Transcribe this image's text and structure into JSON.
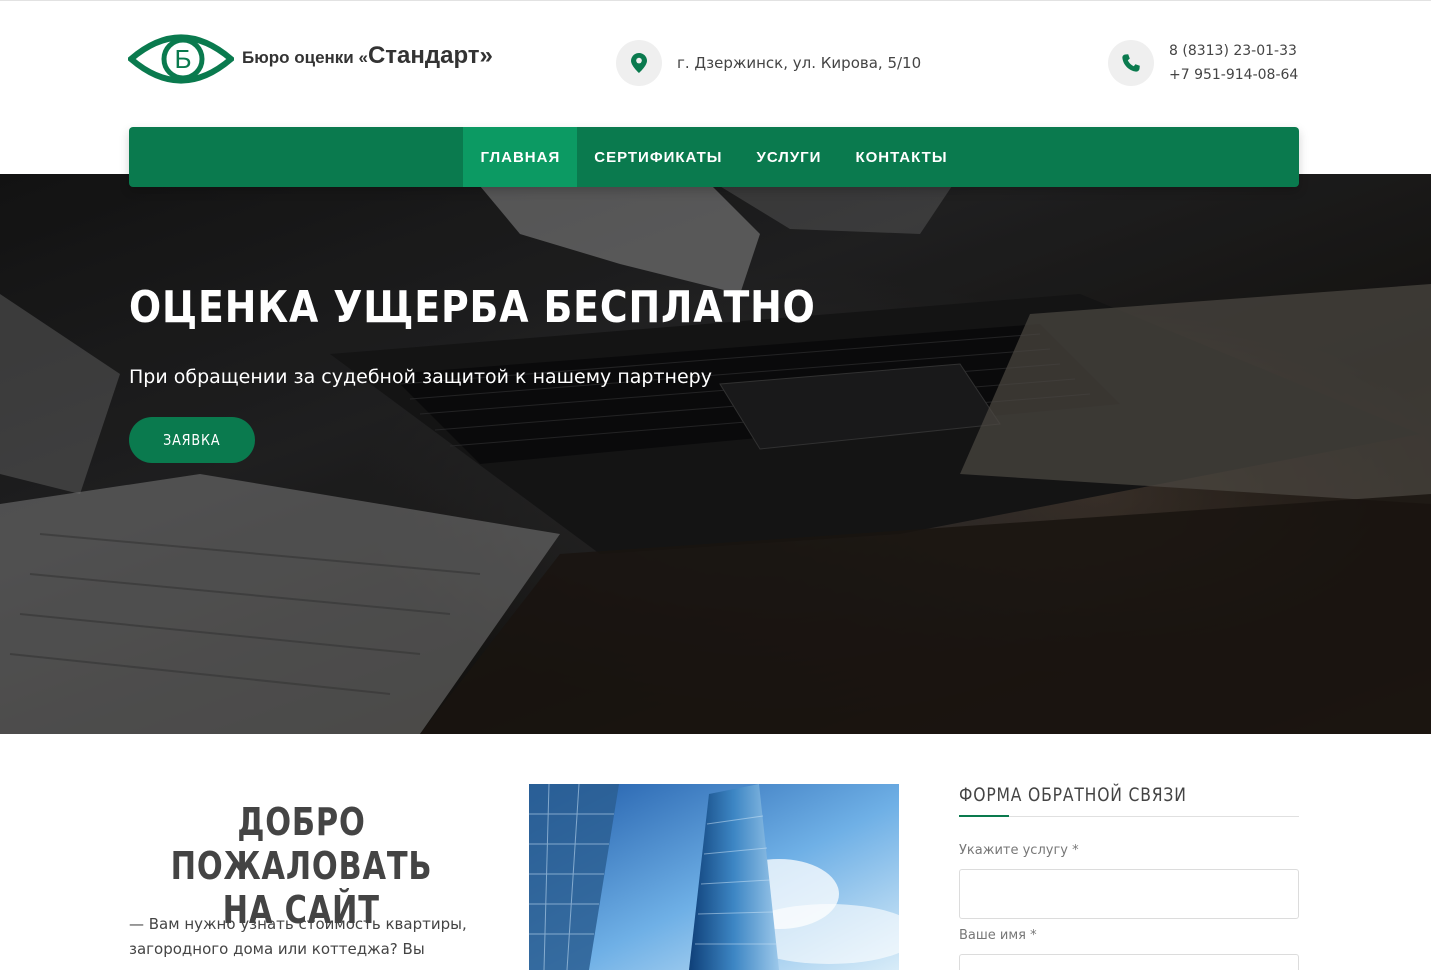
{
  "brand": {
    "name_prefix": "Бюро оценки «",
    "name_main": "Стандарт",
    "name_suffix": "»",
    "logo_letter": "Б",
    "color": "#0a7a4e"
  },
  "contacts": {
    "address": "г. Дзержинск, ул. Кирова, 5/10",
    "address_icon": "map-pin-icon",
    "phone_icon": "phone-icon",
    "phone_1": "8 (8313) 23-01-33",
    "phone_2": "+7 951-914-08-64"
  },
  "nav": {
    "items": [
      {
        "label": "ГЛАВНАЯ",
        "active": true
      },
      {
        "label": "СЕРТИФИКАТЫ",
        "active": false
      },
      {
        "label": "УСЛУГИ",
        "active": false
      },
      {
        "label": "КОНТАКТЫ",
        "active": false
      }
    ],
    "bg": "#0a7a4e",
    "active_bg": "#0c9a63"
  },
  "hero": {
    "title": "ОЦЕНКА УЩЕРБА БЕСПЛАТНО",
    "subtitle": "При обращении за судебной защитой к нашему партнеру",
    "button_label": "ЗАЯВКА"
  },
  "welcome": {
    "title_line1": "ДОБРО ПОЖАЛОВАТЬ",
    "title_line2": "НА САЙТ",
    "text": "—  Вам нужно узнать стоимость квартиры, загородного дома или коттеджа? Вы попали в"
  },
  "form": {
    "title": "ФОРМА ОБРАТНОЙ СВЯЗИ",
    "service_label": "Укажите услугу *",
    "service_value": "",
    "name_label": "Ваше имя *",
    "name_value": ""
  }
}
